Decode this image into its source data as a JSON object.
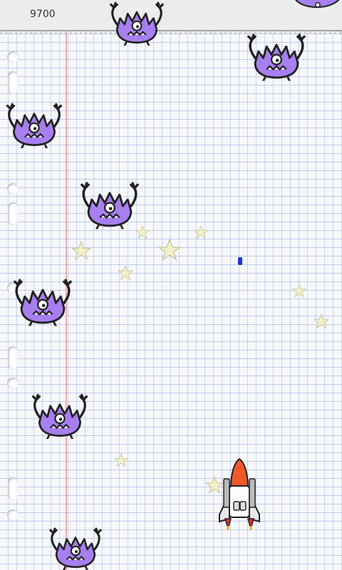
{
  "hud": {
    "score": "9700"
  },
  "colors": {
    "monster": "#a77ff0",
    "paper_line": "#7896d2",
    "margin": "#e68ca0",
    "bullet": "#1a36d8",
    "ship_nose": "#f05a2a"
  },
  "icons": {
    "monster": "purple-monster-icon",
    "ship": "space-shuttle-icon",
    "star": "star-icon",
    "bullet": "bullet-icon"
  }
}
